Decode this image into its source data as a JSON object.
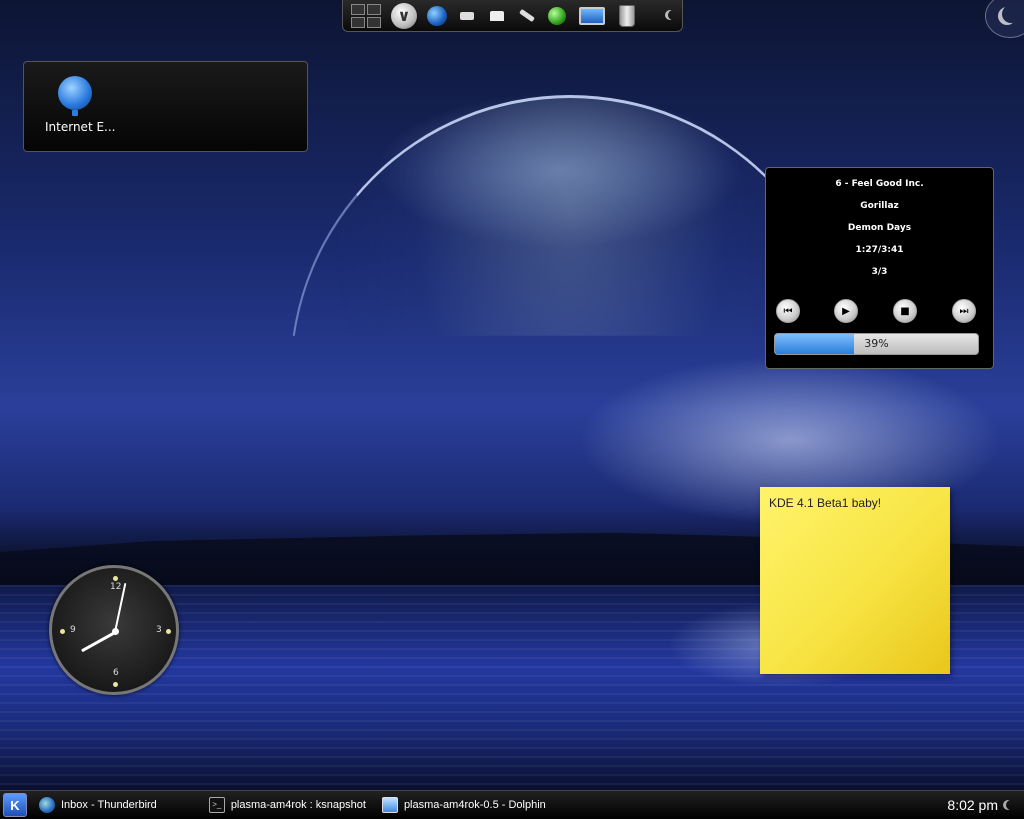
{
  "top_panel": {
    "icons": [
      "pager-icon",
      "device-notifier-icon",
      "konqueror-icon",
      "drive-icon",
      "network-icon",
      "plug-icon",
      "green-status-icon",
      "desktop-icon",
      "trash-icon",
      "moon-icon"
    ]
  },
  "desktop_widgets": {
    "icon_widget": {
      "icon": "internet-explorer-icon",
      "label": "Internet E..."
    },
    "media_player": {
      "track": "6 - Feel Good Inc.",
      "artist": "Gorillaz",
      "album": "Demon Days",
      "time": "1:27/3:41",
      "playlist_position": "3/3",
      "controls": [
        "previous-icon",
        "play-icon",
        "stop-icon",
        "next-icon"
      ],
      "progress_fraction": 0.39,
      "progress_label": "39%"
    },
    "sticky_note": {
      "text": "KDE 4.1 Beta1 baby!"
    },
    "clock": {
      "hours": 8,
      "minutes": 2,
      "numerals": [
        "12",
        "3",
        "6",
        "9"
      ]
    }
  },
  "taskbar": {
    "start_icon": "kde-menu-icon",
    "tasks": [
      {
        "label": "Inbox - Thunderbird",
        "icon": "thunderbird-icon"
      },
      {
        "label": "plasma-am4rok : ksnapshot",
        "icon": "terminal-icon"
      },
      {
        "label": "plasma-am4rok-0.5 - Dolphin",
        "icon": "dolphin-icon"
      }
    ],
    "clock": "8:02 pm",
    "tray_icon": "moon-icon"
  }
}
